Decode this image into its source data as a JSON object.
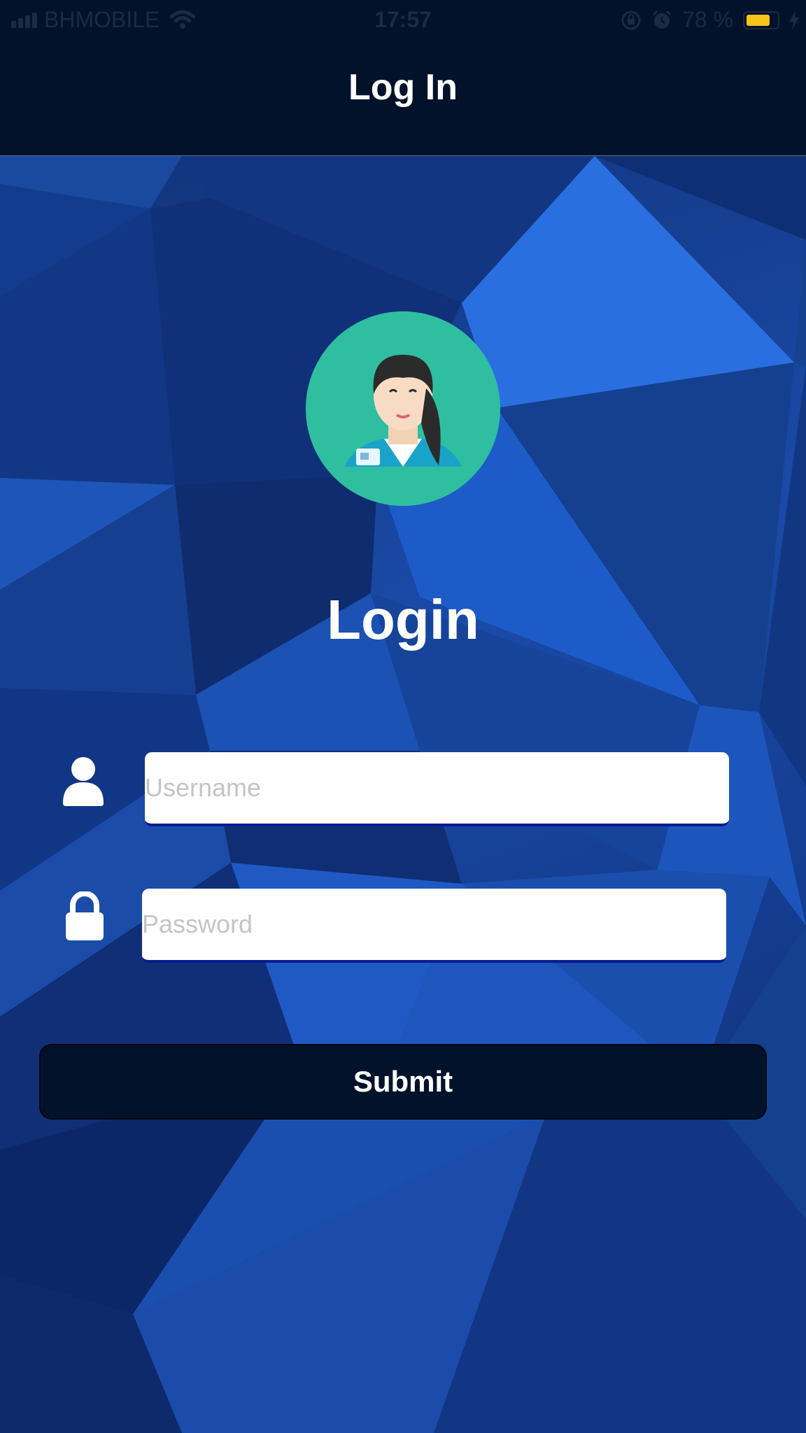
{
  "status_bar": {
    "carrier": "BHMOBILE",
    "time": "17:57",
    "battery_text": "78 %",
    "battery_level": 0.78,
    "battery_color": "#f5c518",
    "icons": [
      "signal-icon",
      "wifi-icon",
      "orientation-lock-icon",
      "alarm-icon",
      "battery-icon",
      "charging-icon"
    ]
  },
  "nav": {
    "title": "Log In"
  },
  "login": {
    "heading": "Login",
    "avatar_icon": "female-user-avatar-icon",
    "username": {
      "icon": "user-icon",
      "placeholder": "Username",
      "value": ""
    },
    "password": {
      "icon": "lock-icon",
      "placeholder": "Password",
      "value": ""
    },
    "submit_label": "Submit"
  },
  "colors": {
    "nav_background": "#03122b",
    "accent_teal": "#2fbfa0",
    "input_underline": "#0a1b8f"
  }
}
